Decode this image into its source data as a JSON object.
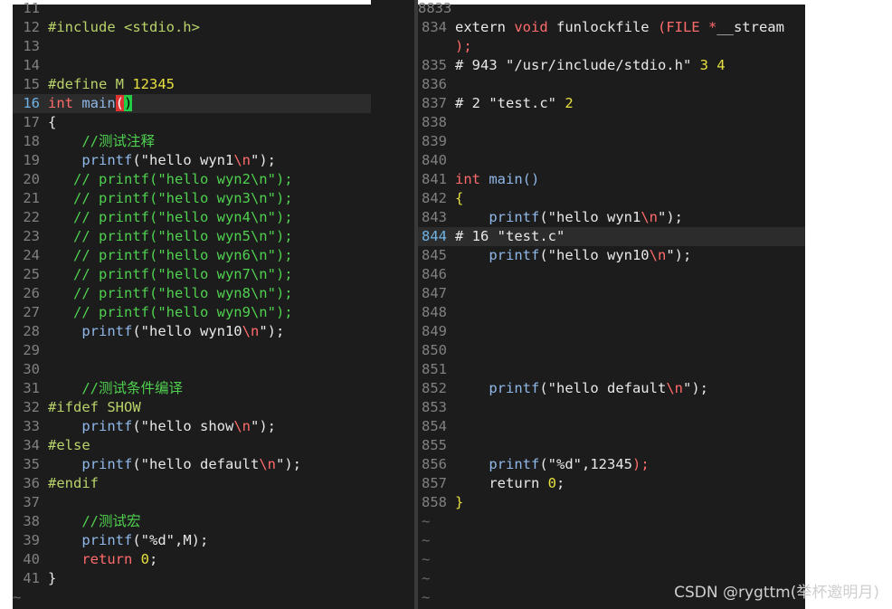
{
  "colors": {
    "background": "#1c1c1c",
    "plain": "#e8e8e8",
    "linenr": "#808080",
    "linenr_current": "#6fb3e6",
    "preproc": "#b9d36a",
    "keyword": "#ff6b6b",
    "type_keyword": "#ff6b6b",
    "function": "#8fb8e8",
    "string": "#e8e8e8",
    "escape": "#ff6b6b",
    "comment": "#4fd04f",
    "number": "#e8e040",
    "paren_match_bg": "#22cc44",
    "paren_match_red_bg": "#dd3333"
  },
  "left_pane": {
    "top_partial": "11",
    "lines": [
      {
        "n": "12",
        "segs": [
          {
            "t": "#include <stdio.h>",
            "c": "preproc"
          }
        ]
      },
      {
        "n": "13",
        "segs": []
      },
      {
        "n": "14",
        "segs": []
      },
      {
        "n": "15",
        "segs": [
          {
            "t": "#define M ",
            "c": "preproc"
          },
          {
            "t": "12345",
            "c": "number"
          }
        ]
      },
      {
        "n": "16",
        "current": true,
        "segs": [
          {
            "t": "int",
            "c": "keyword"
          },
          {
            "t": " ",
            "c": "plain"
          },
          {
            "t": "main",
            "c": "function"
          },
          {
            "t": "(",
            "c": "paren_red"
          },
          {
            "t": ")",
            "c": "paren_green"
          }
        ]
      },
      {
        "n": "17",
        "segs": [
          {
            "t": "{",
            "c": "plain"
          }
        ]
      },
      {
        "n": "18",
        "segs": [
          {
            "t": "    //测试注释",
            "c": "comment"
          }
        ]
      },
      {
        "n": "19",
        "segs": [
          {
            "t": "    ",
            "c": "plain"
          },
          {
            "t": "printf",
            "c": "function"
          },
          {
            "t": "(\"hello wyn1",
            "c": "plain"
          },
          {
            "t": "\\n",
            "c": "escape"
          },
          {
            "t": "\");",
            "c": "plain"
          }
        ]
      },
      {
        "n": "20",
        "segs": [
          {
            "t": "   // printf(\"hello wyn2\\n\");",
            "c": "comment"
          }
        ]
      },
      {
        "n": "21",
        "segs": [
          {
            "t": "   // printf(\"hello wyn3\\n\");",
            "c": "comment"
          }
        ]
      },
      {
        "n": "22",
        "segs": [
          {
            "t": "   // printf(\"hello wyn4\\n\");",
            "c": "comment"
          }
        ]
      },
      {
        "n": "23",
        "segs": [
          {
            "t": "   // printf(\"hello wyn5\\n\");",
            "c": "comment"
          }
        ]
      },
      {
        "n": "24",
        "segs": [
          {
            "t": "   // printf(\"hello wyn6\\n\");",
            "c": "comment"
          }
        ]
      },
      {
        "n": "25",
        "segs": [
          {
            "t": "   // printf(\"hello wyn7\\n\");",
            "c": "comment"
          }
        ]
      },
      {
        "n": "26",
        "segs": [
          {
            "t": "   // printf(\"hello wyn8\\n\");",
            "c": "comment"
          }
        ]
      },
      {
        "n": "27",
        "segs": [
          {
            "t": "   // printf(\"hello wyn9\\n\");",
            "c": "comment"
          }
        ]
      },
      {
        "n": "28",
        "segs": [
          {
            "t": "    ",
            "c": "plain"
          },
          {
            "t": "printf",
            "c": "function"
          },
          {
            "t": "(\"hello wyn10",
            "c": "plain"
          },
          {
            "t": "\\n",
            "c": "escape"
          },
          {
            "t": "\");",
            "c": "plain"
          }
        ]
      },
      {
        "n": "29",
        "segs": []
      },
      {
        "n": "30",
        "segs": []
      },
      {
        "n": "31",
        "segs": [
          {
            "t": "    //测试条件编译",
            "c": "comment"
          }
        ]
      },
      {
        "n": "32",
        "segs": [
          {
            "t": "#ifdef SHOW",
            "c": "preproc"
          }
        ]
      },
      {
        "n": "33",
        "segs": [
          {
            "t": "    ",
            "c": "plain"
          },
          {
            "t": "printf",
            "c": "function"
          },
          {
            "t": "(\"hello show",
            "c": "plain"
          },
          {
            "t": "\\n",
            "c": "escape"
          },
          {
            "t": "\");",
            "c": "plain"
          }
        ]
      },
      {
        "n": "34",
        "segs": [
          {
            "t": "#else",
            "c": "preproc"
          }
        ]
      },
      {
        "n": "35",
        "segs": [
          {
            "t": "    ",
            "c": "plain"
          },
          {
            "t": "printf",
            "c": "function"
          },
          {
            "t": "(\"hello default",
            "c": "plain"
          },
          {
            "t": "\\n",
            "c": "escape"
          },
          {
            "t": "\");",
            "c": "plain"
          }
        ]
      },
      {
        "n": "36",
        "segs": [
          {
            "t": "#endif",
            "c": "preproc"
          }
        ]
      },
      {
        "n": "37",
        "segs": []
      },
      {
        "n": "38",
        "segs": [
          {
            "t": "    //测试宏",
            "c": "comment"
          }
        ]
      },
      {
        "n": "39",
        "segs": [
          {
            "t": "    ",
            "c": "plain"
          },
          {
            "t": "printf",
            "c": "function"
          },
          {
            "t": "(\"%d\",M);",
            "c": "plain"
          }
        ]
      },
      {
        "n": "40",
        "segs": [
          {
            "t": "    ",
            "c": "plain"
          },
          {
            "t": "return",
            "c": "keyword"
          },
          {
            "t": " ",
            "c": "plain"
          },
          {
            "t": "0",
            "c": "number"
          },
          {
            "t": ";",
            "c": "plain"
          }
        ]
      },
      {
        "n": "41",
        "segs": [
          {
            "t": "}",
            "c": "plain"
          }
        ]
      }
    ],
    "tildes": [
      "~"
    ]
  },
  "right_pane": {
    "top_partial": "8833",
    "lines": [
      {
        "n": "834",
        "segs": [
          {
            "t": "extern ",
            "c": "plain"
          },
          {
            "t": "void",
            "c": "keyword"
          },
          {
            "t": " funlockfile ",
            "c": "plain"
          },
          {
            "t": "(FILE *",
            "c": "keyword"
          },
          {
            "t": "__stream",
            "c": "plain"
          }
        ]
      },
      {
        "n": "",
        "segs": [
          {
            "t": ");",
            "c": "keyword"
          }
        ]
      },
      {
        "n": "835",
        "segs": [
          {
            "t": "# 943 ",
            "c": "plain"
          },
          {
            "t": "\"/usr/include/stdio.h\"",
            "c": "plain"
          },
          {
            "t": " 3 4",
            "c": "number"
          }
        ]
      },
      {
        "n": "836",
        "segs": []
      },
      {
        "n": "837",
        "segs": [
          {
            "t": "# 2 ",
            "c": "plain"
          },
          {
            "t": "\"test.c\"",
            "c": "plain"
          },
          {
            "t": " 2",
            "c": "number"
          }
        ]
      },
      {
        "n": "838",
        "segs": []
      },
      {
        "n": "839",
        "segs": []
      },
      {
        "n": "840",
        "segs": []
      },
      {
        "n": "841",
        "segs": [
          {
            "t": "int",
            "c": "keyword"
          },
          {
            "t": " ",
            "c": "plain"
          },
          {
            "t": "main()",
            "c": "function"
          }
        ]
      },
      {
        "n": "842",
        "segs": [
          {
            "t": "{",
            "c": "number"
          }
        ]
      },
      {
        "n": "843",
        "segs": [
          {
            "t": "    ",
            "c": "plain"
          },
          {
            "t": "printf",
            "c": "function"
          },
          {
            "t": "(\"hello wyn1",
            "c": "plain"
          },
          {
            "t": "\\n",
            "c": "escape"
          },
          {
            "t": "\");",
            "c": "plain"
          }
        ]
      },
      {
        "n": "844",
        "current": true,
        "segs": [
          {
            "t": "# 16 ",
            "c": "plain"
          },
          {
            "t": "\"test.c\"",
            "c": "plain"
          }
        ]
      },
      {
        "n": "845",
        "segs": [
          {
            "t": "    ",
            "c": "plain"
          },
          {
            "t": "printf",
            "c": "function"
          },
          {
            "t": "(\"hello wyn10",
            "c": "plain"
          },
          {
            "t": "\\n",
            "c": "escape"
          },
          {
            "t": "\");",
            "c": "plain"
          }
        ]
      },
      {
        "n": "846",
        "segs": []
      },
      {
        "n": "847",
        "segs": []
      },
      {
        "n": "848",
        "segs": []
      },
      {
        "n": "849",
        "segs": []
      },
      {
        "n": "850",
        "segs": []
      },
      {
        "n": "851",
        "segs": []
      },
      {
        "n": "852",
        "segs": [
          {
            "t": "    ",
            "c": "plain"
          },
          {
            "t": "printf",
            "c": "function"
          },
          {
            "t": "(\"hello default",
            "c": "plain"
          },
          {
            "t": "\\n",
            "c": "escape"
          },
          {
            "t": "\");",
            "c": "plain"
          }
        ]
      },
      {
        "n": "853",
        "segs": []
      },
      {
        "n": "854",
        "segs": []
      },
      {
        "n": "855",
        "segs": []
      },
      {
        "n": "856",
        "segs": [
          {
            "t": "    ",
            "c": "plain"
          },
          {
            "t": "printf",
            "c": "function"
          },
          {
            "t": "(\"%d\",",
            "c": "plain"
          },
          {
            "t": "12345",
            "c": "plain"
          },
          {
            "t": ");",
            "c": "keyword"
          }
        ]
      },
      {
        "n": "857",
        "segs": [
          {
            "t": "    ",
            "c": "plain"
          },
          {
            "t": "return",
            "c": "plain"
          },
          {
            "t": " ",
            "c": "plain"
          },
          {
            "t": "0",
            "c": "number"
          },
          {
            "t": ";",
            "c": "plain"
          }
        ]
      },
      {
        "n": "858",
        "segs": [
          {
            "t": "}",
            "c": "number"
          }
        ]
      }
    ],
    "tildes": [
      "~",
      "~",
      "~",
      "~",
      "~"
    ]
  },
  "watermark": "CSDN @rygttm(举杯邀明月)"
}
